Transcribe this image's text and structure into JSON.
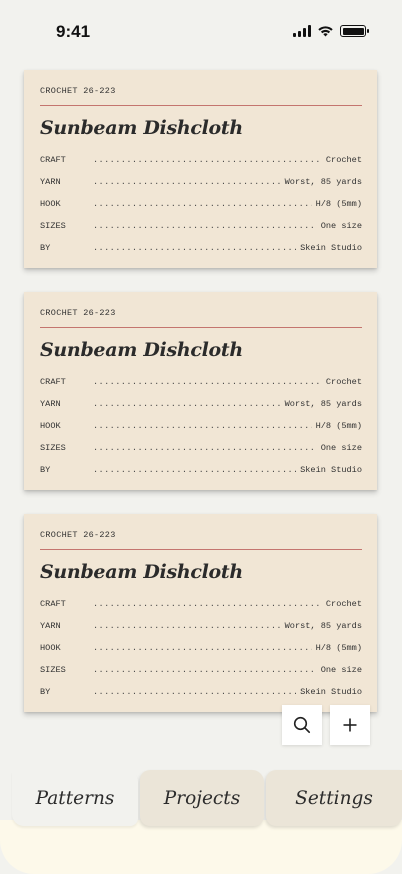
{
  "status_bar": {
    "time": "9:41",
    "icons": [
      "cellular-signal-icon",
      "wifi-icon",
      "battery-icon"
    ]
  },
  "patterns": [
    {
      "code": "CROCHET 26-223",
      "title": "Sunbeam Dishcloth",
      "specs": [
        {
          "key": "CRAFT",
          "value": "Crochet"
        },
        {
          "key": "YARN",
          "value": "Worst, 85 yards"
        },
        {
          "key": "HOOK",
          "value": "H/8 (5mm)"
        },
        {
          "key": "SIZES",
          "value": "One size"
        },
        {
          "key": "BY",
          "value": "Skein Studio"
        }
      ]
    },
    {
      "code": "CROCHET 26-223",
      "title": "Sunbeam Dishcloth",
      "specs": [
        {
          "key": "CRAFT",
          "value": "Crochet"
        },
        {
          "key": "YARN",
          "value": "Worst, 85 yards"
        },
        {
          "key": "HOOK",
          "value": "H/8 (5mm)"
        },
        {
          "key": "SIZES",
          "value": "One size"
        },
        {
          "key": "BY",
          "value": "Skein Studio"
        }
      ]
    },
    {
      "code": "CROCHET 26-223",
      "title": "Sunbeam Dishcloth",
      "specs": [
        {
          "key": "CRAFT",
          "value": "Crochet"
        },
        {
          "key": "YARN",
          "value": "Worst, 85 yards"
        },
        {
          "key": "HOOK",
          "value": "H/8 (5mm)"
        },
        {
          "key": "SIZES",
          "value": "One size"
        },
        {
          "key": "BY",
          "value": "Skein Studio"
        }
      ]
    }
  ],
  "actions": {
    "search_icon": "search-icon",
    "add_icon": "plus-icon"
  },
  "tabs": [
    {
      "label": "Patterns",
      "active": true
    },
    {
      "label": "Projects",
      "active": false
    },
    {
      "label": "Settings",
      "active": false
    }
  ],
  "colors": {
    "background": "#f2f2ee",
    "card": "#f1e6d5",
    "rule": "#c4756f",
    "tab_inactive": "#ebe5d8",
    "text": "#2b2b2b"
  }
}
